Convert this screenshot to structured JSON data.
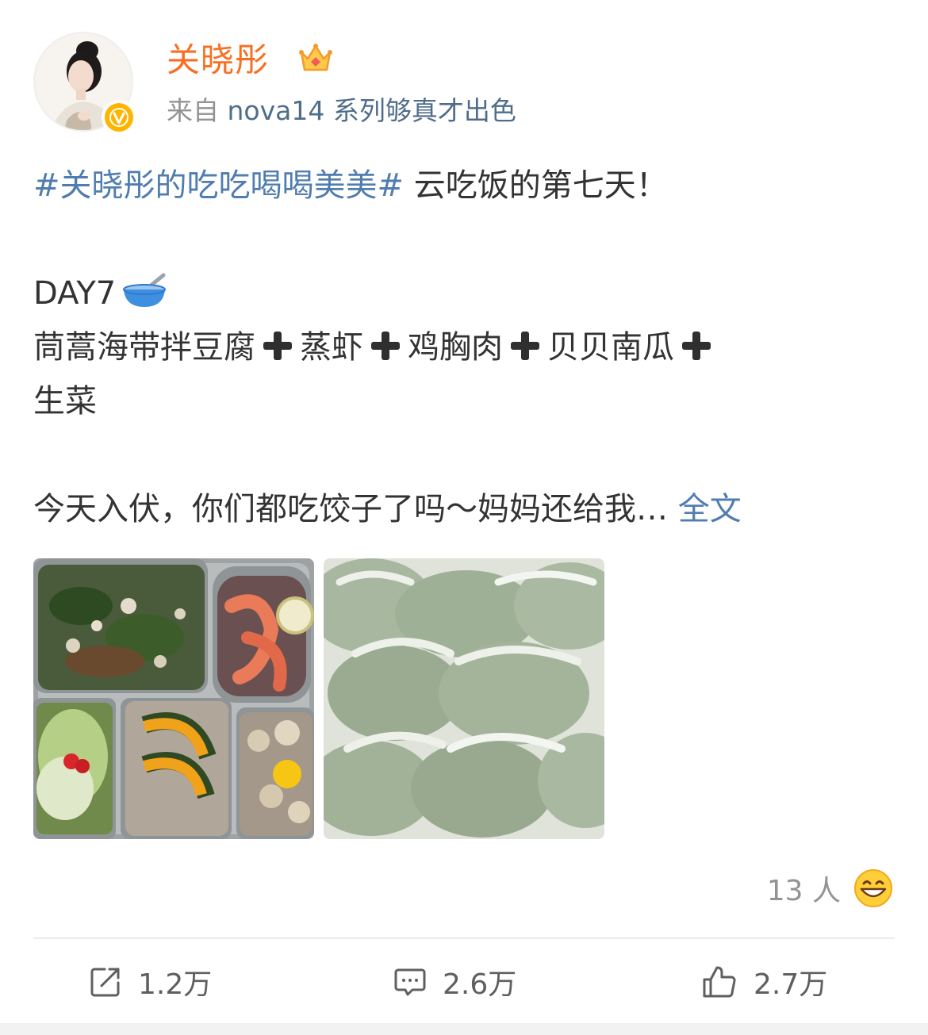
{
  "header": {
    "username": "关晓彤",
    "source_prefix": "来自",
    "source_device": "nova14 系列够真才出色"
  },
  "post": {
    "hashtag": "#关晓彤的吃吃喝喝美美#",
    "line1_text": " 云吃饭的第七天！",
    "day": "DAY7",
    "menu": [
      "茼蒿海带拌豆腐",
      "蒸虾",
      "鸡胸肉",
      "贝贝南瓜",
      "生菜"
    ],
    "last_line": "今天入伏，你们都吃饺子了吗～妈妈还给我…",
    "more_label": "全文"
  },
  "likers": {
    "count_text": "13 人"
  },
  "actions": {
    "repost": "1.2万",
    "comment": "2.6万",
    "like": "2.7万"
  }
}
